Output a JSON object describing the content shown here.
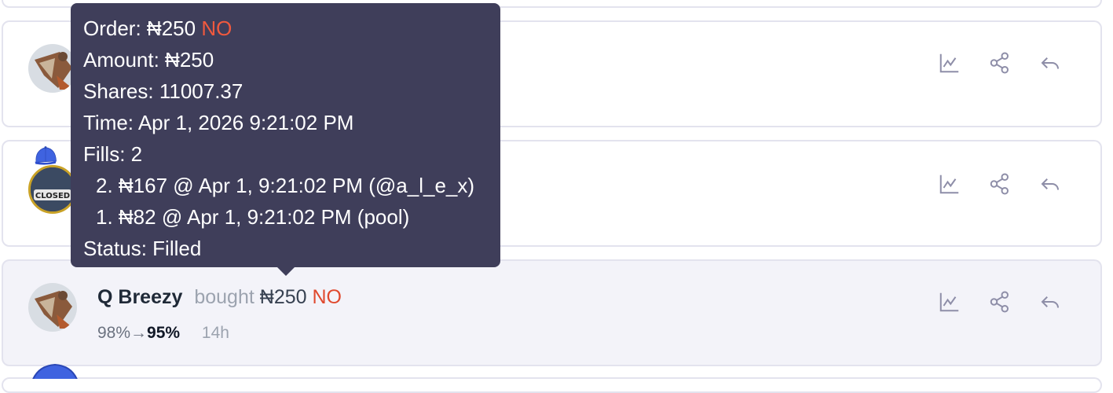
{
  "tooltip": {
    "order_label": "Order: ",
    "order_amount": "₦250",
    "order_outcome": "NO",
    "amount": "Amount: ₦250",
    "shares": "Shares: 11007.37",
    "time": "Time: Apr 1, 2026 9:21:02 PM",
    "fills": "Fills: 2",
    "fill_lines": [
      "2. ₦167 @ Apr 1, 9:21:02 PM (@a_l_e_x)",
      "1. ₦82 @ Apr 1, 9:21:02 PM (pool)"
    ],
    "status": "Status: Filled"
  },
  "feed": {
    "items": [
      {
        "user": "Q Breezy",
        "verb": "bought",
        "amount": "₦250",
        "outcome": "NO",
        "prob_from": "98%",
        "arrow": "→",
        "prob_to": "95%",
        "ago": "14h"
      }
    ],
    "closed_badge": "CLOSED"
  },
  "icons": {
    "chart": "chart-icon",
    "share": "share-icon",
    "reply": "reply-icon"
  },
  "colors": {
    "no": "#e0492e",
    "tooltip_bg": "#3f3e5a",
    "card_border": "#e3e3ee",
    "icon": "#8e8ea8"
  }
}
